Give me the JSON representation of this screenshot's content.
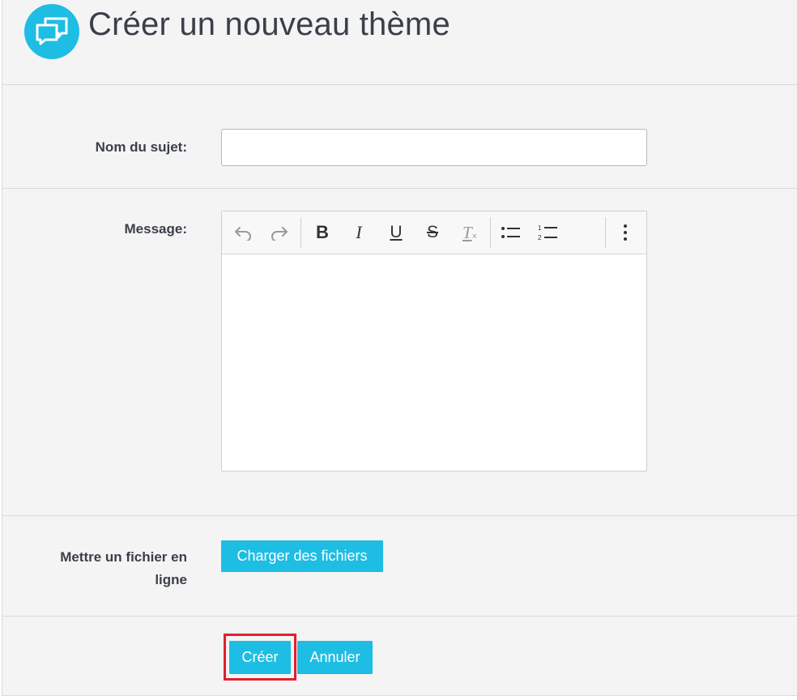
{
  "page": {
    "title": "Créer un nouveau thème",
    "logo_icon": "chat-bubbles-icon",
    "accent": "#1ebde3"
  },
  "form": {
    "subject_label": "Nom du sujet:",
    "subject_value": "",
    "message_label": "Message:",
    "upload_label_line1": "Mettre un fichier en",
    "upload_label_line2": "ligne",
    "upload_button": "Charger des fichiers"
  },
  "editor": {
    "toolbar": [
      "undo-icon",
      "redo-icon",
      "bold-icon",
      "italic-icon",
      "underline-icon",
      "strikethrough-icon",
      "clear-formatting-icon",
      "bulleted-list-icon",
      "numbered-list-icon",
      "more-options-icon"
    ],
    "content": ""
  },
  "actions": {
    "create": "Créer",
    "cancel": "Annuler",
    "highlight_color": "#e0202e"
  }
}
